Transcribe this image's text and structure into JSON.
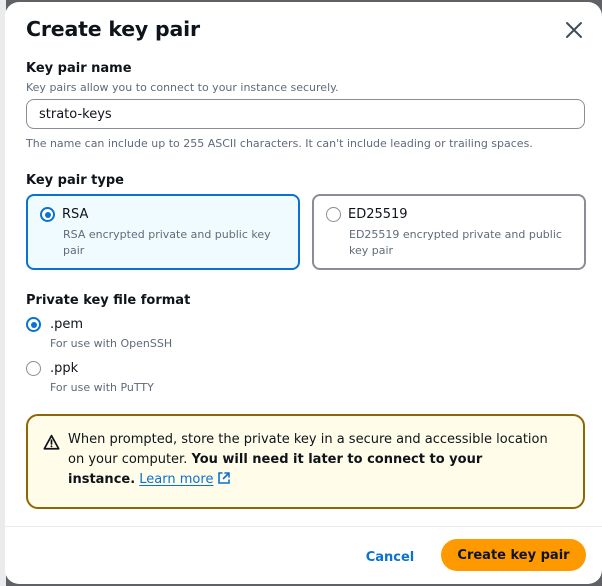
{
  "modal": {
    "title": "Create key pair",
    "close_icon": "close-icon"
  },
  "key_pair_name": {
    "label": "Key pair name",
    "description": "Key pairs allow you to connect to your instance securely.",
    "value": "strato-keys",
    "constraint": "The name can include up to 255 ASCII characters. It can't include leading or trailing spaces."
  },
  "key_pair_type": {
    "label": "Key pair type",
    "selected": "RSA",
    "options": [
      {
        "title": "RSA",
        "description": "RSA encrypted private and public key pair",
        "selected": true
      },
      {
        "title": "ED25519",
        "description": "ED25519 encrypted private and public key pair",
        "selected": false
      }
    ]
  },
  "file_format": {
    "label": "Private key file format",
    "selected": ".pem",
    "options": [
      {
        "title": ".pem",
        "description": "For use with OpenSSH",
        "selected": true
      },
      {
        "title": ".ppk",
        "description": "For use with PuTTY",
        "selected": false
      }
    ]
  },
  "alert": {
    "icon": "warning-icon",
    "text_prefix": "When prompted, store the private key in a secure and accessible location on your computer.",
    "text_bold": "You will need it later to connect to your instance.",
    "link_text": "Learn more",
    "link_icon": "external-link-icon"
  },
  "footer": {
    "cancel_label": "Cancel",
    "create_label": "Create key pair"
  },
  "colors": {
    "accent": "#0972d3",
    "primary_button": "#ff9900",
    "warning_border": "#8d6605",
    "warning_bg": "#fffce9",
    "selected_tile_bg": "#f0fbff"
  }
}
